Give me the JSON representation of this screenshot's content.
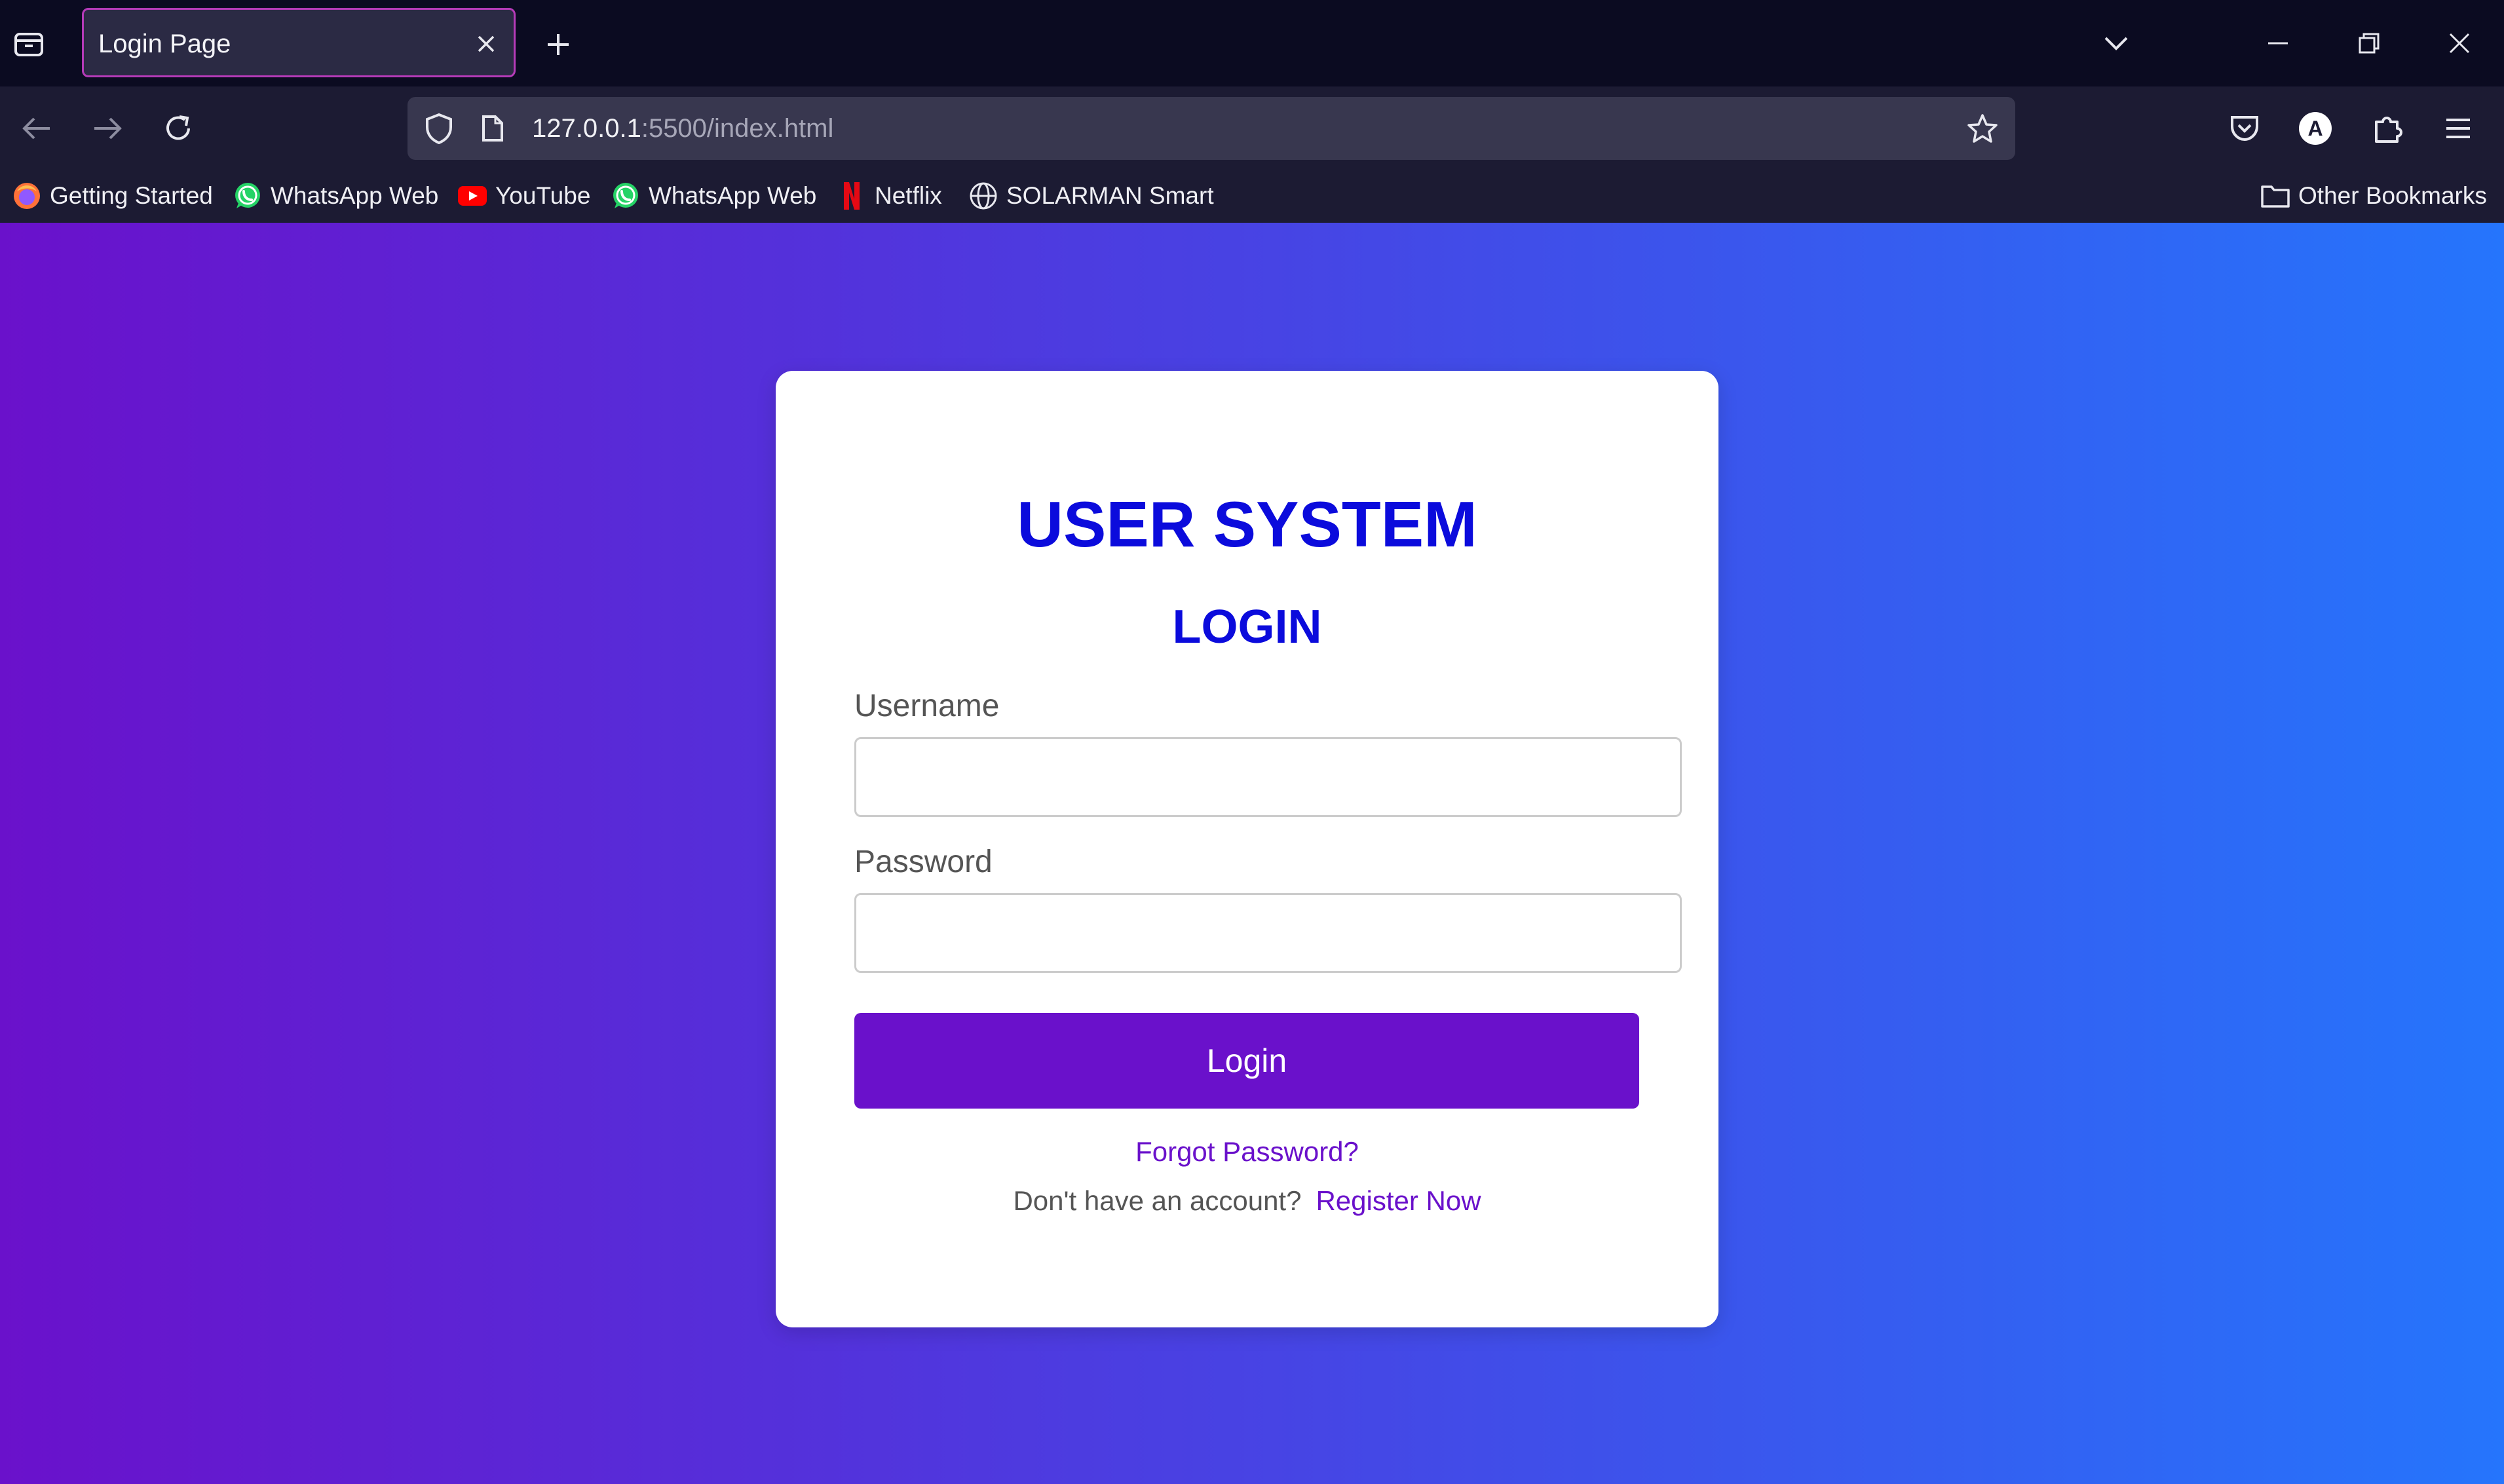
{
  "browser": {
    "tab": {
      "title": "Login Page"
    },
    "url": {
      "host": "127.0.0.1",
      "rest": ":5500/index.html"
    },
    "bookmarks": [
      {
        "label": "Getting Started",
        "icon": "firefox-icon"
      },
      {
        "label": "WhatsApp Web",
        "icon": "whatsapp-icon"
      },
      {
        "label": "YouTube",
        "icon": "youtube-icon"
      },
      {
        "label": "WhatsApp Web",
        "icon": "whatsapp-icon"
      },
      {
        "label": "Netflix",
        "icon": "netflix-icon"
      },
      {
        "label": "SOLARMAN Smart",
        "icon": "globe-icon"
      }
    ],
    "other_bookmarks": "Other Bookmarks",
    "account_initial": "A",
    "colors": {
      "tab_border": "#b53bb8",
      "tabbar_bg": "#0b0b21",
      "toolbar_bg": "#1c1b33",
      "urlbar_bg": "#38374f"
    }
  },
  "page": {
    "title": "USER SYSTEM",
    "subtitle": "LOGIN",
    "username_label": "Username",
    "username_value": "",
    "password_label": "Password",
    "password_value": "",
    "login_button": "Login",
    "forgot_link": "Forgot Password?",
    "register_prompt": "Don't have an account?",
    "register_link": "Register Now",
    "colors": {
      "gradient_start": "#6a11cb",
      "gradient_end": "#2575fc",
      "heading": "#0b0bdc",
      "accent": "#6a11cb"
    }
  }
}
